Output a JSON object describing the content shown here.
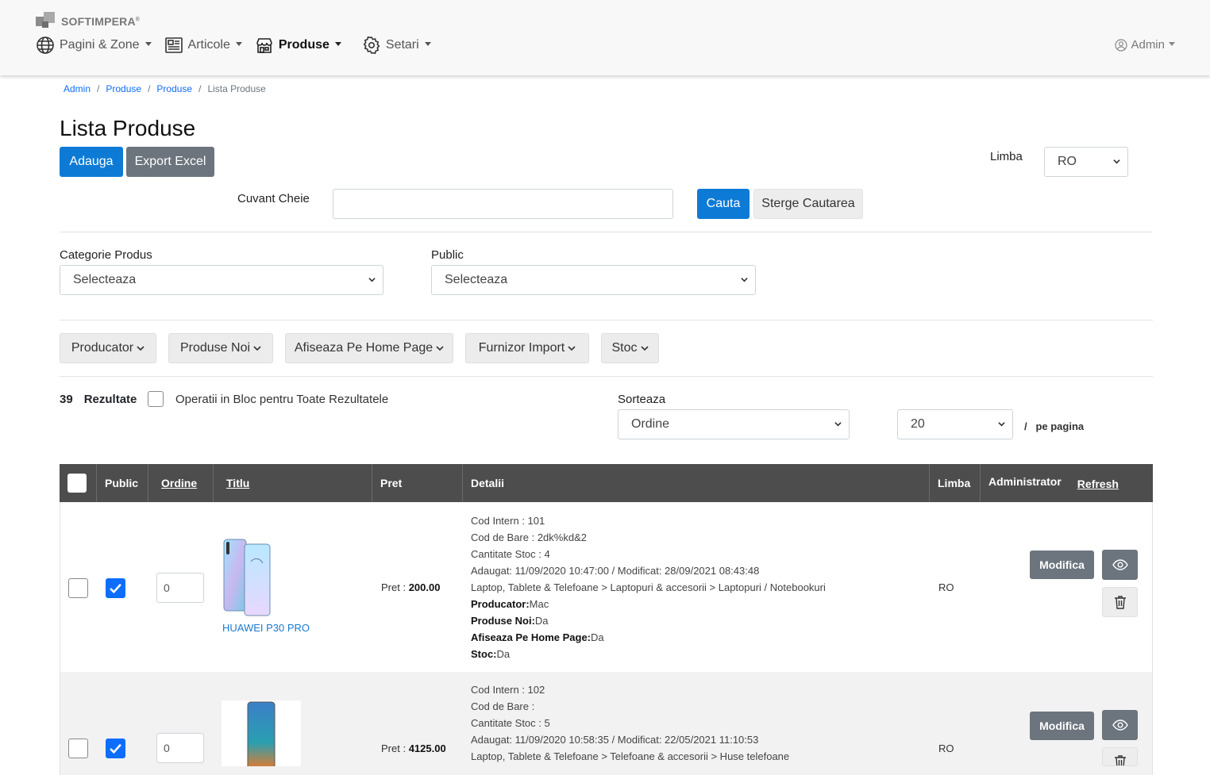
{
  "brand": {
    "name": "SOFTIMPERA",
    "mark": "®"
  },
  "nav": {
    "items": [
      {
        "label": "Pagini & Zone",
        "icon": "globe-icon",
        "active": false
      },
      {
        "label": "Articole",
        "icon": "newspaper-icon",
        "active": false
      },
      {
        "label": "Produse",
        "icon": "shop-icon",
        "active": true
      },
      {
        "label": "Setari",
        "icon": "gear-icon",
        "active": false
      }
    ],
    "user": "Admin"
  },
  "breadcrumb": [
    "Admin",
    "Produse",
    "Produse",
    "Lista Produse"
  ],
  "page_title": "Lista Produse",
  "toolbar": {
    "add_label": "Adauga",
    "export_label": "Export Excel"
  },
  "language": {
    "label": "Limba",
    "value": "RO"
  },
  "search": {
    "label": "Cuvant Cheie",
    "value": "",
    "search_label": "Cauta",
    "clear_label": "Sterge Cautarea"
  },
  "filters": {
    "category_label": "Categorie Produs",
    "category_value": "Selecteaza",
    "public_label": "Public",
    "public_value": "Selecteaza",
    "buttons": [
      "Producator",
      "Produse Noi",
      "Afiseaza Pe Home Page",
      "Furnizor Import",
      "Stoc"
    ]
  },
  "results": {
    "count": "39",
    "label": "Rezultate",
    "bulk_label": "Operatii in Bloc pentru Toate Rezultatele",
    "sort_label": "Sorteaza",
    "sort_value": "Ordine",
    "per_page_value": "20",
    "per_page_label": "/   pe pagina"
  },
  "table": {
    "headers": {
      "public": "Public",
      "order": "Ordine",
      "title": "Titlu",
      "price": "Pret",
      "details": "Detalii",
      "language": "Limba",
      "admin": "Administrator",
      "refresh": "Refresh"
    },
    "rows": [
      {
        "checked": false,
        "public": true,
        "order": "0",
        "title": "HUAWEI P30 PRO",
        "price_label": "Pret : ",
        "price": "200.00",
        "details": {
          "cod_intern": "Cod Intern : 101",
          "cod_bare": "Cod de Bare : 2dk%kd&2",
          "stoc": "Cantitate Stoc : 4",
          "dates": "Adaugat: 11/09/2020 10:47:00 / Modificat: 28/09/2021 08:43:48",
          "category": "Laptop, Tablete & Telefoane > Laptopuri & accesorii > Laptopuri / Notebookuri",
          "producator_label": "Producator:",
          "producator": "Mac",
          "produse_noi_label": "Produse Noi:",
          "produse_noi": "Da",
          "home_label": "Afiseaza Pe Home Page:",
          "home": "Da",
          "stoc_label": "Stoc:",
          "stoc_value": "Da"
        },
        "language": "RO",
        "edit_label": "Modifica"
      },
      {
        "checked": false,
        "public": true,
        "order": "0",
        "title": "",
        "price_label": "Pret : ",
        "price": "4125.00",
        "details": {
          "cod_intern": "Cod Intern : 102",
          "cod_bare": "Cod de Bare :",
          "stoc": "Cantitate Stoc : 5",
          "dates": "Adaugat: 11/09/2020 10:58:35 / Modificat: 22/05/2021 11:10:53",
          "category": "Laptop, Tablete & Telefoane > Telefoane & accesorii > Huse telefoane"
        },
        "language": "RO",
        "edit_label": "Modifica"
      }
    ]
  },
  "colors": {
    "primary": "#0d7bd6",
    "secondary": "#6c757d",
    "header_bg": "#4d4d4d",
    "link": "#1a7ad0"
  }
}
